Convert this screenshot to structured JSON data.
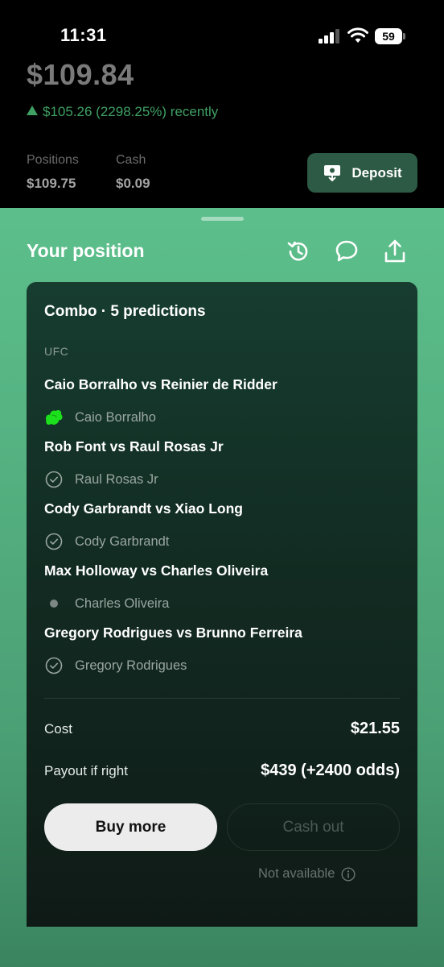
{
  "status_bar": {
    "time": "11:31",
    "battery": "59"
  },
  "account": {
    "balance": "$109.84",
    "change": "$105.26 (2298.25%) recently",
    "positions_label": "Positions",
    "positions_value": "$109.75",
    "cash_label": "Cash",
    "cash_value": "$0.09",
    "deposit_label": "Deposit"
  },
  "position": {
    "title": "Your position",
    "header_icons": [
      "history-icon",
      "comment-icon",
      "share-icon"
    ],
    "card_title": "Combo · 5 predictions",
    "league": "UFC",
    "predictions": [
      {
        "match": "Caio Borralho vs Reinier de Ridder",
        "pick": "Caio Borralho",
        "status": "won-sticker"
      },
      {
        "match": "Rob Font vs Raul Rosas Jr",
        "pick": "Raul Rosas Jr",
        "status": "won"
      },
      {
        "match": "Cody Garbrandt vs Xiao Long",
        "pick": "Cody Garbrandt",
        "status": "won"
      },
      {
        "match": "Max Holloway vs Charles Oliveira",
        "pick": "Charles Oliveira",
        "status": "pending"
      },
      {
        "match": "Gregory Rodrigues vs Brunno Ferreira",
        "pick": "Gregory Rodrigues",
        "status": "won"
      }
    ],
    "cost_label": "Cost",
    "cost_value": "$21.55",
    "payout_label": "Payout if right",
    "payout_value": "$439 (+2400 odds)",
    "buy_more_label": "Buy more",
    "cash_out_label": "Cash out",
    "not_available_label": "Not available"
  },
  "colors": {
    "accent_green": "#3fa063",
    "sheet_green": "#5cbf8b",
    "card_dark": "#122b22"
  }
}
